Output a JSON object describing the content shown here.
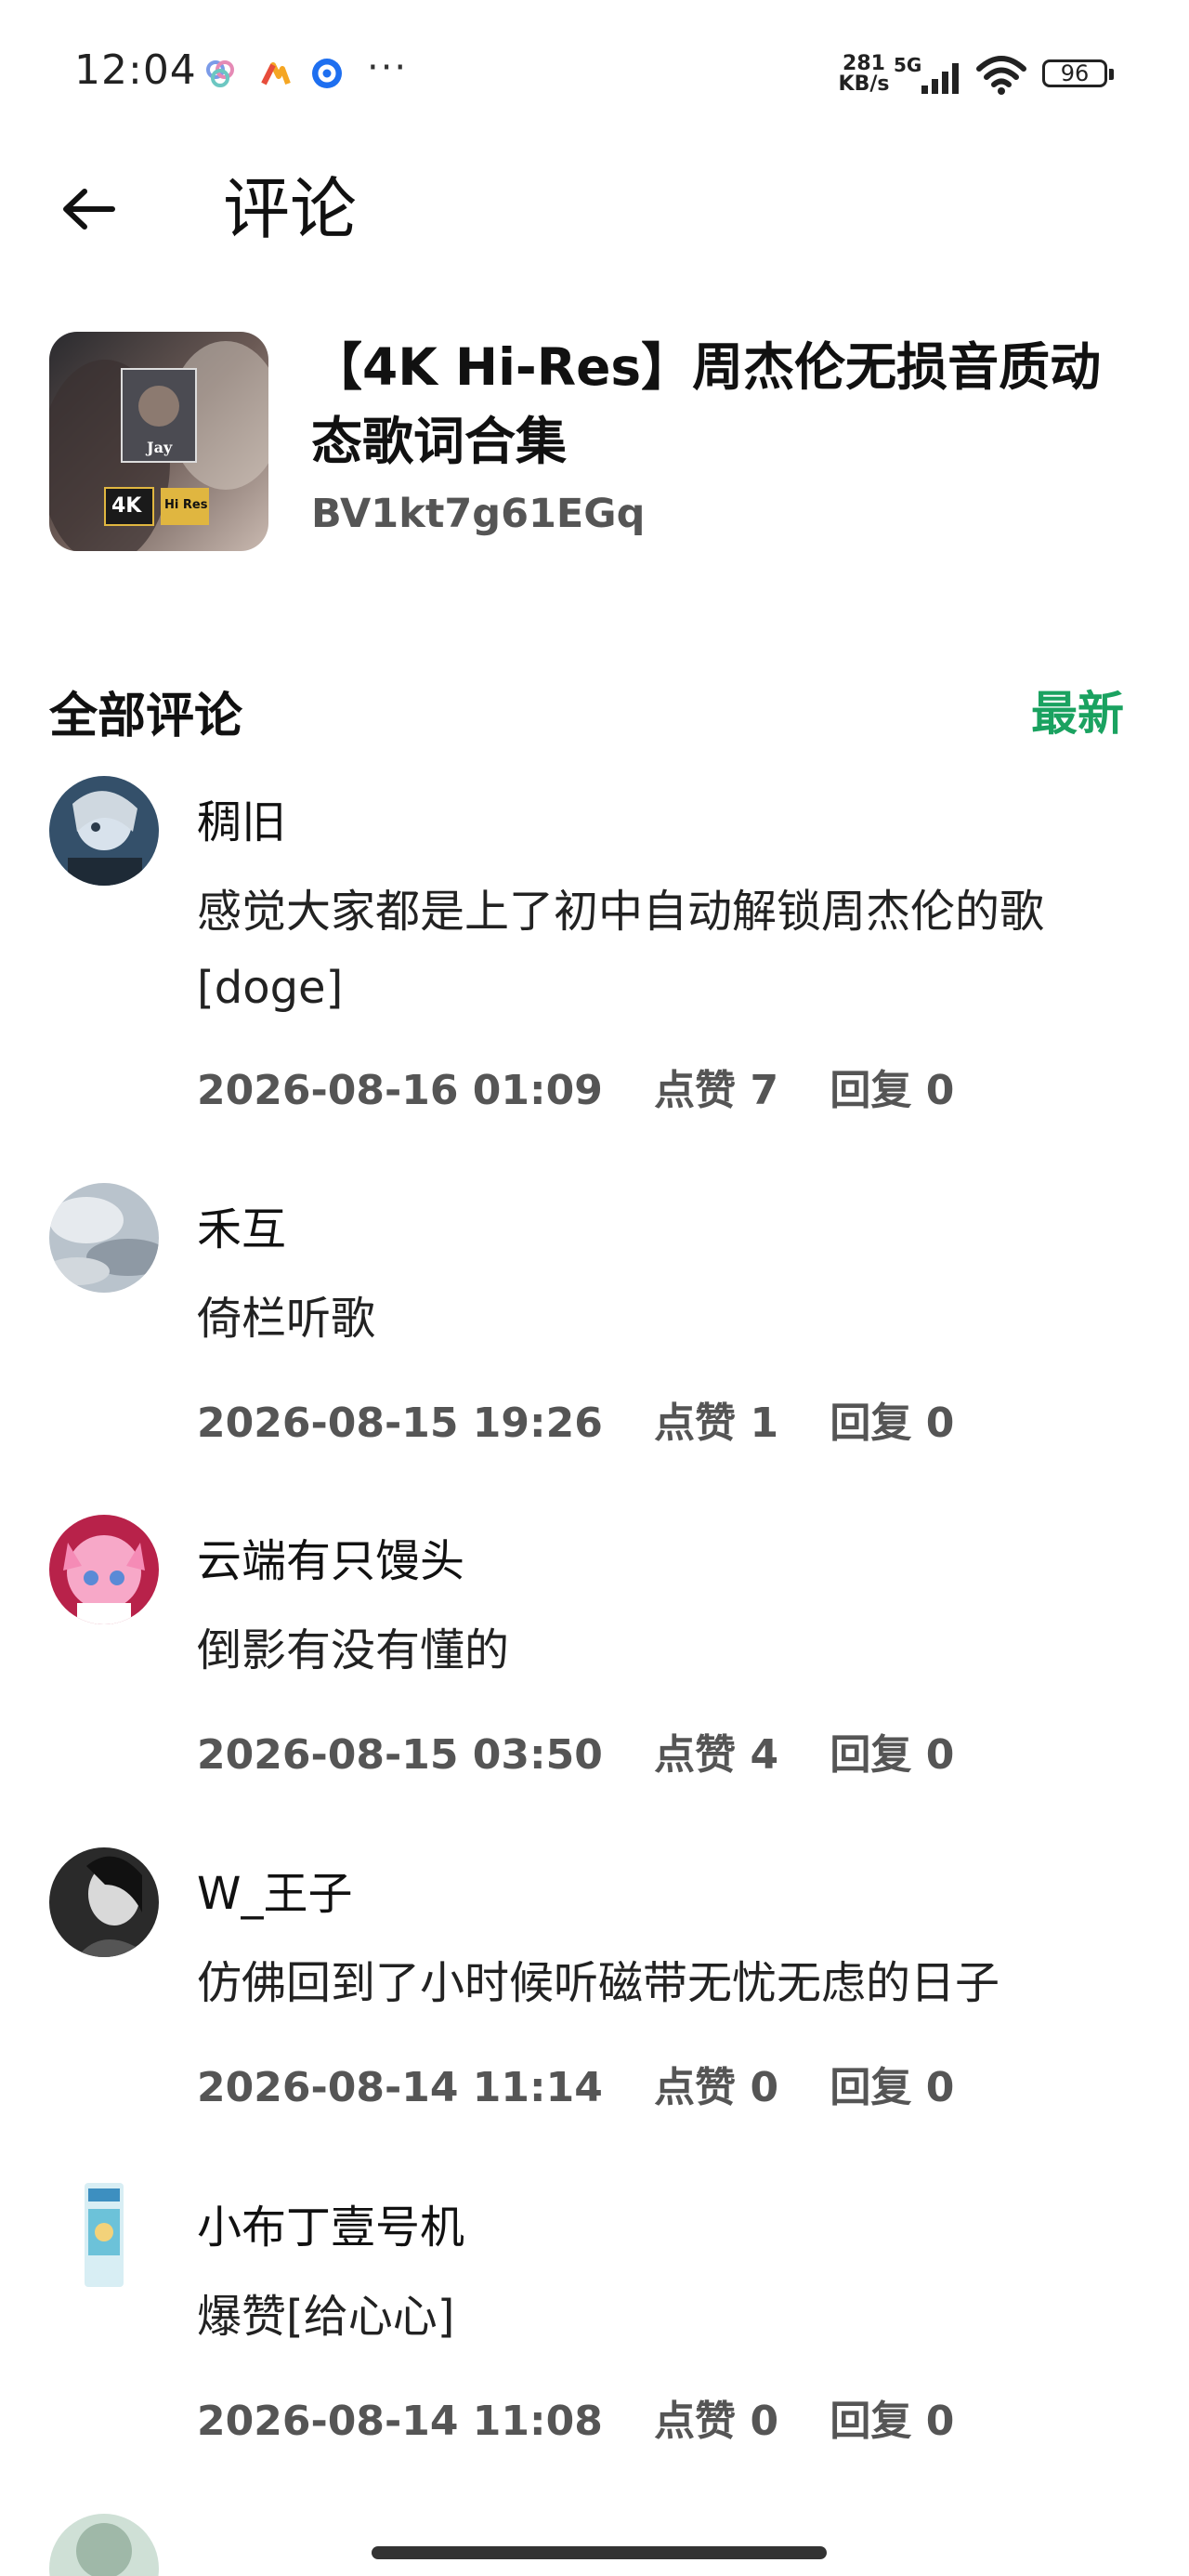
{
  "status_bar": {
    "time": "12:04",
    "more": "···",
    "net_speed_value": "281",
    "net_speed_unit": "KB/s",
    "network_type": "5G",
    "battery": "96"
  },
  "header": {
    "title": "评论"
  },
  "video": {
    "title": "【4K Hi-Res】周杰伦无损音质动态歌词合集",
    "bvid": "BV1kt7g61EGq",
    "thumb_badges": {
      "a": "4K",
      "b": "Hi Res",
      "cap": "Jay"
    }
  },
  "comments_section": {
    "title": "全部评论",
    "sort_label": "最新"
  },
  "comments": [
    {
      "name": "稠旧",
      "text": "感觉大家都是上了初中自动解锁周杰伦的歌[doge]",
      "time": "2026-08-16 01:09",
      "likes": "点赞 7",
      "replies": "回复 0"
    },
    {
      "name": "禾互",
      "text": "倚栏听歌",
      "time": "2026-08-15 19:26",
      "likes": "点赞 1",
      "replies": "回复 0"
    },
    {
      "name": "云端有只馒头",
      "text": "倒影有没有懂的",
      "time": "2026-08-15 03:50",
      "likes": "点赞 4",
      "replies": "回复 0"
    },
    {
      "name": "W_王子",
      "text": "仿佛回到了小时候听磁带无忧无虑的日子",
      "time": "2026-08-14 11:14",
      "likes": "点赞 0",
      "replies": "回复 0"
    },
    {
      "name": "小布丁壹号机",
      "text": "爆赞[给心心]",
      "time": "2026-08-14 11:08",
      "likes": "点赞 0",
      "replies": "回复 0"
    }
  ],
  "colors": {
    "accent": "#1aa260"
  }
}
